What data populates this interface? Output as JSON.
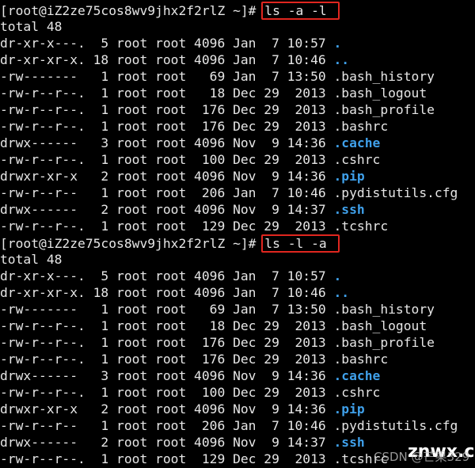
{
  "blocks": [
    {
      "prompt": "[root@iZ2ze75cos8wv9jhx2f2rlZ ~]# ",
      "command": "ls -a -l",
      "total": "total 48",
      "entries": [
        {
          "meta": "dr-xr-x---.  5 root root 4096 Jan  7 10:57 ",
          "name": ".",
          "dir": true
        },
        {
          "meta": "dr-xr-xr-x. 18 root root 4096 Jan  7 10:46 ",
          "name": "..",
          "dir": true
        },
        {
          "meta": "-rw-------   1 root root   69 Jan  7 13:50 ",
          "name": ".bash_history",
          "dir": false
        },
        {
          "meta": "-rw-r--r--.  1 root root   18 Dec 29  2013 ",
          "name": ".bash_logout",
          "dir": false
        },
        {
          "meta": "-rw-r--r--.  1 root root  176 Dec 29  2013 ",
          "name": ".bash_profile",
          "dir": false
        },
        {
          "meta": "-rw-r--r--.  1 root root  176 Dec 29  2013 ",
          "name": ".bashrc",
          "dir": false
        },
        {
          "meta": "drwx------   3 root root 4096 Nov  9 14:36 ",
          "name": ".cache",
          "dir": true
        },
        {
          "meta": "-rw-r--r--.  1 root root  100 Dec 29  2013 ",
          "name": ".cshrc",
          "dir": false
        },
        {
          "meta": "drwxr-xr-x   2 root root 4096 Nov  9 14:36 ",
          "name": ".pip",
          "dir": true
        },
        {
          "meta": "-rw-r--r--   1 root root  206 Jan  7 10:46 ",
          "name": ".pydistutils.cfg",
          "dir": false
        },
        {
          "meta": "drwx------   2 root root 4096 Nov  9 14:37 ",
          "name": ".ssh",
          "dir": true
        },
        {
          "meta": "-rw-r--r--.  1 root root  129 Dec 29  2013 ",
          "name": ".tcshrc",
          "dir": false
        }
      ]
    },
    {
      "prompt": "[root@iZ2ze75cos8wv9jhx2f2rlZ ~]# ",
      "command": "ls -l -a",
      "total": "total 48",
      "entries": [
        {
          "meta": "dr-xr-x---.  5 root root 4096 Jan  7 10:57 ",
          "name": ".",
          "dir": true
        },
        {
          "meta": "dr-xr-xr-x. 18 root root 4096 Jan  7 10:46 ",
          "name": "..",
          "dir": true
        },
        {
          "meta": "-rw-------   1 root root   69 Jan  7 13:50 ",
          "name": ".bash_history",
          "dir": false
        },
        {
          "meta": "-rw-r--r--.  1 root root   18 Dec 29  2013 ",
          "name": ".bash_logout",
          "dir": false
        },
        {
          "meta": "-rw-r--r--.  1 root root  176 Dec 29  2013 ",
          "name": ".bash_profile",
          "dir": false
        },
        {
          "meta": "-rw-r--r--.  1 root root  176 Dec 29  2013 ",
          "name": ".bashrc",
          "dir": false
        },
        {
          "meta": "drwx------   3 root root 4096 Nov  9 14:36 ",
          "name": ".cache",
          "dir": true
        },
        {
          "meta": "-rw-r--r--.  1 root root  100 Dec 29  2013 ",
          "name": ".cshrc",
          "dir": false
        },
        {
          "meta": "drwxr-xr-x   2 root root 4096 Nov  9 14:36 ",
          "name": ".pip",
          "dir": true
        },
        {
          "meta": "-rw-r--r--   1 root root  206 Jan  7 10:46 ",
          "name": ".pydistutils.cfg",
          "dir": false
        },
        {
          "meta": "drwx------   2 root root 4096 Nov  9 14:37 ",
          "name": ".ssh",
          "dir": true
        },
        {
          "meta": "-rw-r--r--.  1 root root  129 Dec 29  2013 ",
          "name": ".tcshrc",
          "dir": false
        }
      ]
    }
  ],
  "colors": {
    "background": "#000000",
    "text": "#e6e6e6",
    "directory": "#3fa0ea",
    "highlight_box": "#e0261f"
  },
  "watermark": {
    "site": "znwx.cn",
    "author": "CSDN @芒果329"
  }
}
